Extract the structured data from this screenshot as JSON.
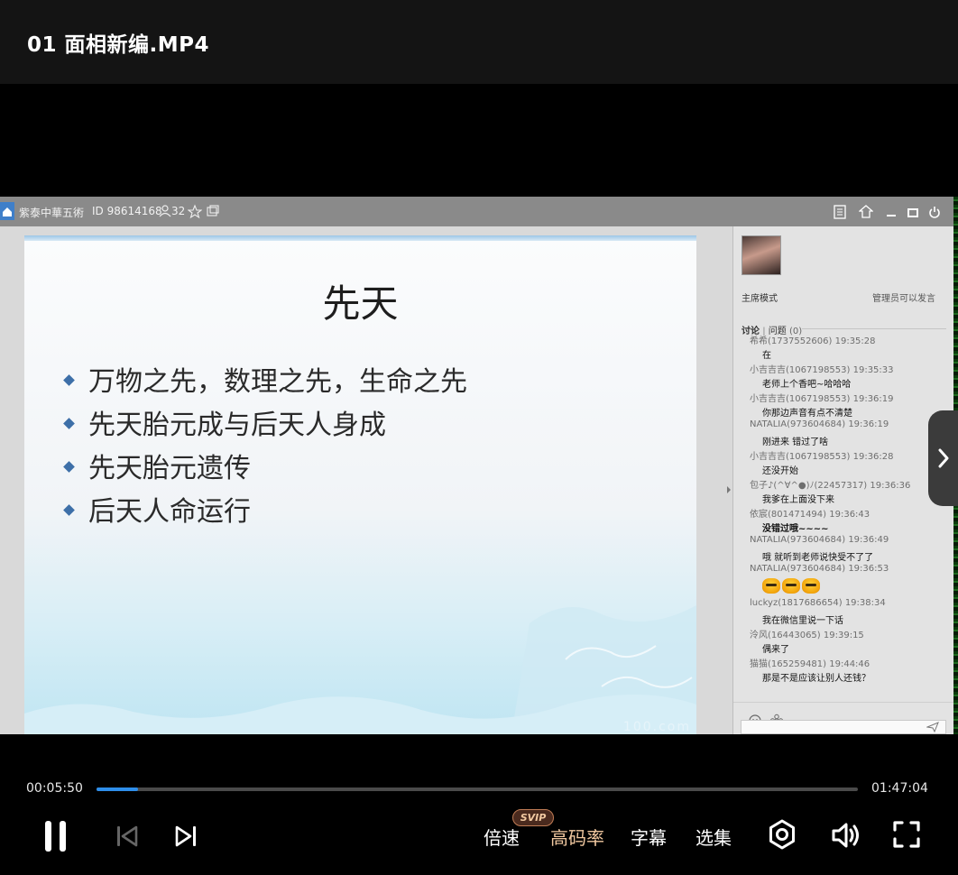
{
  "header": {
    "title": "01 面相新编.MP4"
  },
  "app_window": {
    "room_name": "紫泰中華五術",
    "room_id": "ID 98614168",
    "viewer_count": "32"
  },
  "slide": {
    "title": "先天",
    "bullets": [
      "万物之先，数理之先，生命之先",
      "先天胎元成与后天人身成",
      "先天胎元遗传",
      "后天人命运行"
    ],
    "watermark": "100.com"
  },
  "chat": {
    "mode": "主席模式",
    "admin_note": "管理员可以发言",
    "tab_discussion": "讨论",
    "tab_question": "问题",
    "question_count": "(0)",
    "messages": [
      {
        "user": "希希(1737552606) 19:35:28",
        "text": "在"
      },
      {
        "user": "小吉吉吉(1067198553) 19:35:33",
        "text": "老师上个香吧~哈哈哈"
      },
      {
        "user": "小吉吉吉(1067198553) 19:36:19",
        "text": "你那边声音有点不清楚"
      },
      {
        "user": "NATALIA(973604684) 19:36:19",
        "text": "刚进来 错过了啥"
      },
      {
        "user": "小吉吉吉(1067198553) 19:36:28",
        "text": "还没开始"
      },
      {
        "user": "包子♪(^∀^●)ﾉ(22457317) 19:36:36",
        "text": "我爹在上面没下来"
      },
      {
        "user": "依宸(801471494) 19:36:43",
        "text": "没错过哦~~~~"
      },
      {
        "user": "NATALIA(973604684) 19:36:49",
        "text": "哦 就听到老师说快受不了了"
      },
      {
        "user": "NATALIA(973604684) 19:36:53",
        "text": ""
      },
      {
        "user": "luckyz(1817686654) 19:38:34",
        "text": "我在微信里说一下话"
      },
      {
        "user": "泠风(16443065) 19:39:15",
        "text": "偶来了"
      },
      {
        "user": "猫猫(165259481) 19:44:46",
        "text": "那是不是应该让别人还钱？"
      }
    ]
  },
  "player": {
    "current_time": "00:05:50",
    "total_time": "01:47:04",
    "progress": 0.054,
    "speed_label": "倍速",
    "svip_badge": "SVIP",
    "hq_label": "高码率",
    "subtitle_label": "字幕",
    "episodes_label": "选集",
    "accent_color": "#2e8eea",
    "hq_color": "#f1c8a0"
  }
}
